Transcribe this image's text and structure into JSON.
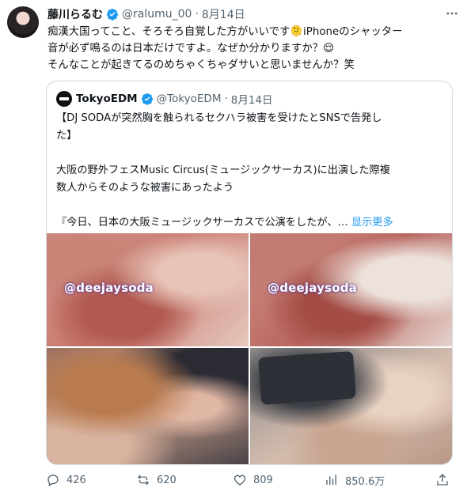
{
  "author": {
    "name": "藤川らるむ",
    "handle": "@ralumu_00",
    "separator": "·",
    "date": "8月14日"
  },
  "tweet_text": [
    "痴漢大国ってこと、そろそろ自覚した方がいいです🫠iPhoneのシャッター",
    "音が必ず鳴るのは日本だけですよ。なぜか分かりますか？😌",
    "そんなことが起きてるのめちゃくちゃダサいと思いませんか？笑"
  ],
  "quote": {
    "name": "TokyoEDM",
    "handle": "@TokyoEDM",
    "separator": "·",
    "date": "8月14日",
    "lines": [
      "【DJ SODAが突然胸を触られるセクハラ被害を受けたとSNSで告発し",
      "た】",
      "",
      "大阪の野外フェスMusic Circus(ミュージックサーカス)に出演した際複",
      "数人からそのような被害にあったよう",
      ""
    ],
    "last_line": "『今日、日本の大阪ミュージックサーカスで公演をしたが、…",
    "show_more": "显示更多",
    "media_watermark": "@deejaysoda"
  },
  "actions": {
    "replies": "426",
    "retweets": "620",
    "likes": "809",
    "views": "850.6万"
  },
  "colors": {
    "accent": "#1d9bf0",
    "muted_text": "#536471",
    "border": "#cfd9de"
  }
}
